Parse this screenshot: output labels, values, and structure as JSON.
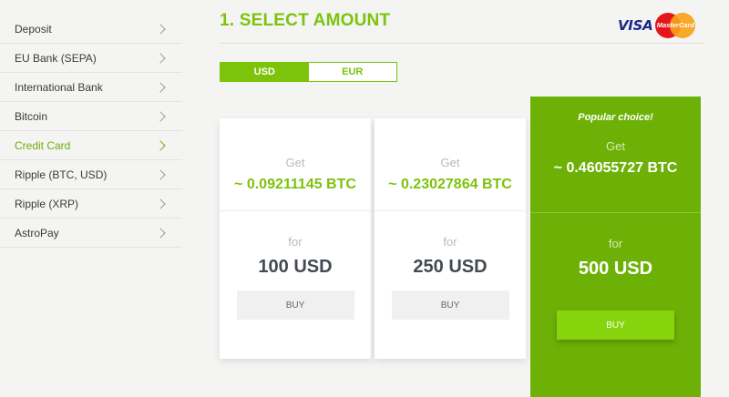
{
  "sidebar": {
    "items": [
      {
        "label": "Deposit"
      },
      {
        "label": "EU Bank (SEPA)"
      },
      {
        "label": "International Bank"
      },
      {
        "label": "Bitcoin"
      },
      {
        "label": "Credit Card"
      },
      {
        "label": "Ripple (BTC, USD)"
      },
      {
        "label": "Ripple (XRP)"
      },
      {
        "label": "AstroPay"
      }
    ],
    "active_index": 4
  },
  "header": {
    "title": "1. SELECT AMOUNT",
    "visa_logo": "VISA",
    "mastercard_logo": "MasterCard"
  },
  "currency": {
    "options": [
      "USD",
      "EUR"
    ],
    "selected": "USD"
  },
  "offers": [
    {
      "get_label": "Get",
      "btc": "~ 0.09211145 BTC",
      "for_label": "for",
      "amount": "100 USD",
      "buy_label": "BUY"
    },
    {
      "get_label": "Get",
      "btc": "~ 0.23027864 BTC",
      "for_label": "for",
      "amount": "250 USD",
      "buy_label": "BUY"
    },
    {
      "popular_label": "Popular choice!",
      "get_label": "Get",
      "btc": "~ 0.46055727 BTC",
      "for_label": "for",
      "amount": "500 USD",
      "buy_label": "BUY"
    }
  ],
  "colors": {
    "accent": "#7cc30c",
    "featured_bg": "#6db107",
    "page_bg": "#f4f4f2"
  }
}
